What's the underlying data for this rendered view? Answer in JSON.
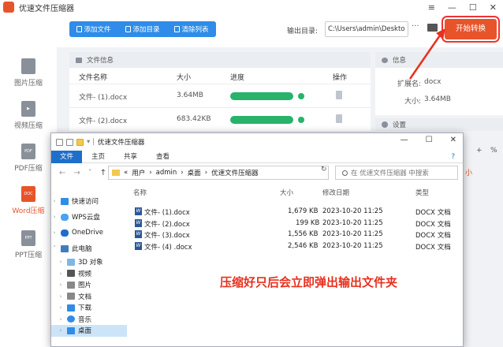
{
  "app": {
    "title": "优速文件压缩器"
  },
  "window_controls": [
    "≡",
    "—",
    "☐",
    "✕"
  ],
  "sidebar": {
    "items": [
      {
        "label": "图片压缩",
        "icon": "image-file-icon",
        "icon_text": ""
      },
      {
        "label": "视频压缩",
        "icon": "video-file-icon",
        "icon_text": "▶"
      },
      {
        "label": "PDF压缩",
        "icon": "pdf-file-icon",
        "icon_text": "PDF"
      },
      {
        "label": "Word压缩",
        "icon": "doc-file-icon",
        "icon_text": "DOC",
        "active": true
      },
      {
        "label": "PPT压缩",
        "icon": "ppt-file-icon",
        "icon_text": "PPT"
      }
    ]
  },
  "toolbar": {
    "add_file": "添加文件",
    "add_folder": "添加目录",
    "clear_list": "清除列表",
    "output_label": "输出目录:",
    "output_path": "C:\\Users\\admin\\Deskto",
    "more": "···",
    "start": "开始转换"
  },
  "file_panel": {
    "header": "文件信息",
    "columns": [
      "文件名称",
      "大小",
      "进度",
      "操作"
    ],
    "rows": [
      {
        "name": "文件- (1).docx",
        "size": "3.64MB",
        "progress": 1.0
      },
      {
        "name": "文件- (2).docx",
        "size": "683.42KB",
        "progress": 1.0
      }
    ]
  },
  "info_panel": {
    "header": "信息",
    "ext_label": "扩展名:",
    "ext_value": "docx",
    "size_label": "大小:",
    "size_value": "3.64MB"
  },
  "settings_panel": {
    "header": "设置"
  },
  "behind": {
    "pct": "%",
    "plus": "+",
    "small_char": "小"
  },
  "explorer": {
    "title": "优速文件压缩器",
    "ribbon": [
      "文件",
      "主页",
      "共享",
      "查看"
    ],
    "breadcrumb": [
      "«",
      "用户",
      "›",
      "admin",
      "›",
      "桌面",
      "›",
      "优速文件压缩器"
    ],
    "search_placeholder": "在 优速文件压缩器 中搜索",
    "nav_arrows": [
      "←",
      "→",
      "˅",
      "↑"
    ],
    "nav": [
      {
        "label": "快速访问",
        "icon": "star-icon",
        "color": "#2f8ce8",
        "chev": "›"
      },
      {
        "label": "WPS云盘",
        "icon": "cloud-icon",
        "color": "#4aa3f0",
        "chev": "›"
      },
      {
        "label": "OneDrive",
        "icon": "onedrive-icon",
        "color": "#1e6fc9",
        "chev": "›"
      },
      {
        "label": "此电脑",
        "icon": "computer-icon",
        "color": "#3c7fc0",
        "chev": "˅"
      },
      {
        "label": "3D 对象",
        "icon": "cube-icon",
        "color": "#7fb6e8",
        "chev": "›"
      },
      {
        "label": "视频",
        "icon": "video-folder-icon",
        "color": "#555",
        "chev": "›"
      },
      {
        "label": "图片",
        "icon": "picture-folder-icon",
        "color": "#888",
        "chev": "›"
      },
      {
        "label": "文档",
        "icon": "document-folder-icon",
        "color": "#888",
        "chev": "›"
      },
      {
        "label": "下载",
        "icon": "download-icon",
        "color": "#2f8ce8",
        "chev": "›"
      },
      {
        "label": "音乐",
        "icon": "music-icon",
        "color": "#2f8ce8",
        "chev": "›"
      },
      {
        "label": "桌面",
        "icon": "desktop-icon",
        "color": "#2f8ce8",
        "chev": "›",
        "selected": true
      }
    ],
    "columns": [
      "名称",
      "大小",
      "修改日期",
      "类型"
    ],
    "files": [
      {
        "name": "文件- (1).docx",
        "size": "1,679 KB",
        "date": "2023-10-20 11:25",
        "type": "DOCX 文档"
      },
      {
        "name": "文件- (2).docx",
        "size": "199 KB",
        "date": "2023-10-20 11:25",
        "type": "DOCX 文档"
      },
      {
        "name": "文件- (3).docx",
        "size": "1,556 KB",
        "date": "2023-10-20 11:25",
        "type": "DOCX 文档"
      },
      {
        "name": "文件- (4) .docx",
        "size": "2,546 KB",
        "date": "2023-10-20 11:25",
        "type": "DOCX 文档"
      }
    ],
    "controls": [
      "—",
      "☐",
      "✕"
    ],
    "help": "?"
  },
  "annotation": "压缩好只后会立即弹出输出文件夹",
  "colors": {
    "accent": "#e8542a",
    "primary": "#2f8ce8",
    "progress": "#27b36a",
    "annotation": "#e8301e"
  }
}
